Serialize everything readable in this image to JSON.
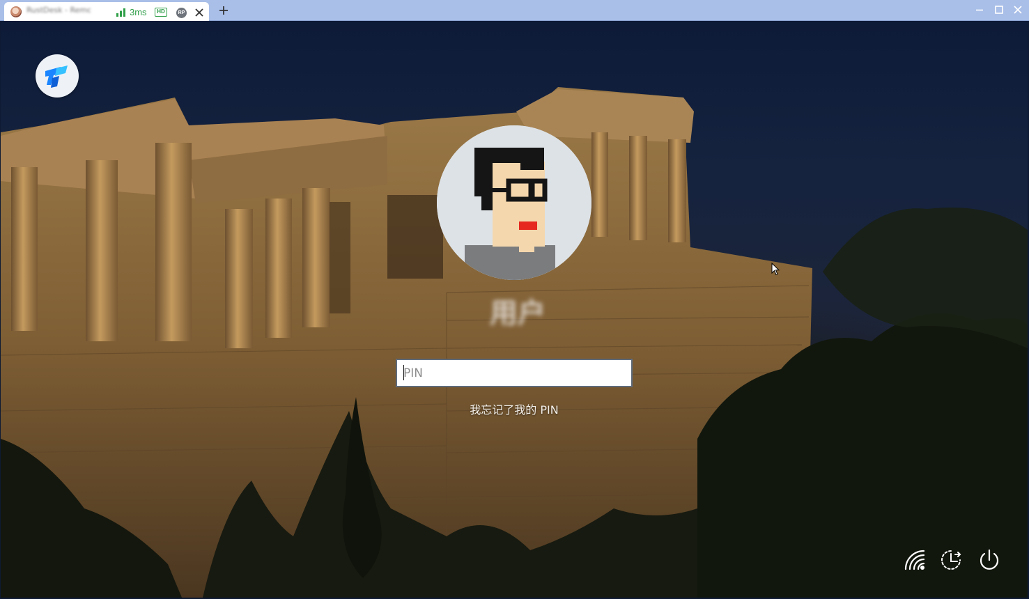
{
  "browser": {
    "tab": {
      "title": "RustDesk - Remote",
      "latency": "3ms",
      "quality_badge": "HD",
      "protocol_badge": "RP"
    },
    "icons": {
      "favicon": "profile-favicon-icon",
      "signal": "signal-bars-icon",
      "close": "close-icon",
      "new_tab": "plus-icon",
      "minimize": "minimize-icon",
      "maximize": "maximize-icon",
      "close_window": "close-window-icon"
    },
    "colors": {
      "titlebar": "#a9bfe8",
      "latency_green": "#2f9e48"
    }
  },
  "lock_screen": {
    "app_logo": "teamviewer-logo-icon",
    "avatar": "pixel-art-avatar",
    "username": "用户",
    "pin_input": {
      "placeholder": "PIN",
      "value": ""
    },
    "forgot_pin_link": "我忘记了我的 PIN",
    "corner_icons": [
      "network-wifi-icon",
      "accessibility-icon",
      "power-icon"
    ],
    "colors": {
      "sky": "#0d1a38",
      "stone": "#8a6a3e",
      "input_border": "#5f6b7a"
    }
  }
}
